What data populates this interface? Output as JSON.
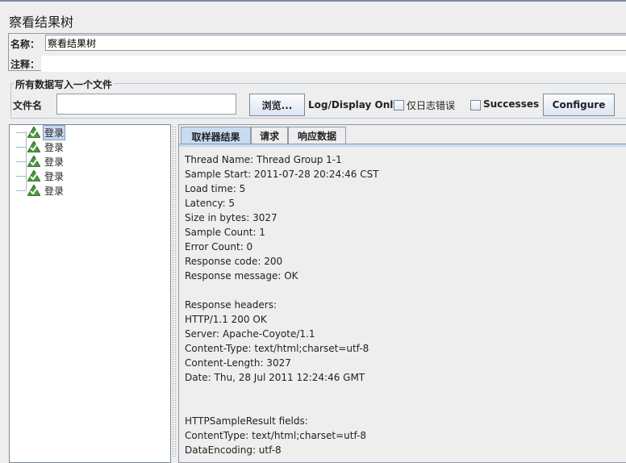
{
  "title": "察看结果树",
  "name_label": "名称：",
  "name_value": "察看结果树",
  "comment_label": "注释：",
  "comment_value": "",
  "file_group": {
    "title": "所有数据写入一个文件",
    "file_label": "文件名",
    "file_value": "",
    "browse_label": "浏览...",
    "log_display_label": "Log/Display Only:",
    "errors_label": "仅日志错误",
    "successes_label": "Successes",
    "configure_label": "Configure"
  },
  "tree": {
    "items": [
      {
        "label": "登录",
        "status": "success",
        "selected": true
      },
      {
        "label": "登录",
        "status": "success"
      },
      {
        "label": "登录",
        "status": "success"
      },
      {
        "label": "登录",
        "status": "success"
      },
      {
        "label": "登录",
        "status": "success"
      }
    ]
  },
  "tabs": [
    {
      "label": "取样器结果",
      "active": true
    },
    {
      "label": "请求"
    },
    {
      "label": "响应数据"
    }
  ],
  "content_lines": [
    "Thread Name: Thread Group 1-1",
    "Sample Start: 2011-07-28 20:24:46 CST",
    "Load time: 5",
    "Latency: 5",
    "Size in bytes: 3027",
    "Sample Count: 1",
    "Error Count: 0",
    "Response code: 200",
    "Response message: OK",
    "",
    "Response headers:",
    "HTTP/1.1 200 OK",
    "Server: Apache-Coyote/1.1",
    "Content-Type: text/html;charset=utf-8",
    "Content-Length: 3027",
    "Date: Thu, 28 Jul 2011 12:24:46 GMT",
    "",
    "",
    "HTTPSampleResult fields:",
    "ContentType: text/html;charset=utf-8",
    "DataEncoding: utf-8"
  ]
}
